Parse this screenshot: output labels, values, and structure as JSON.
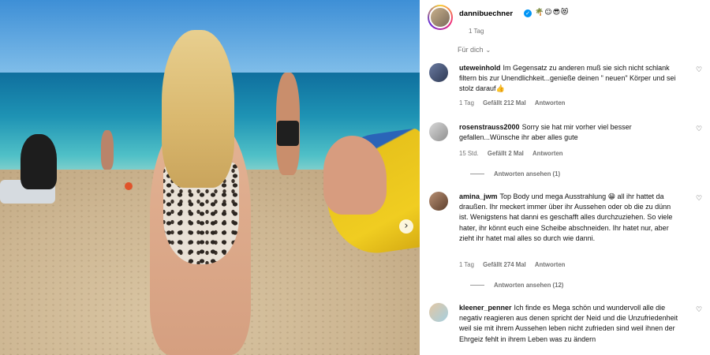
{
  "post": {
    "username": "dannibuechner",
    "header_emojis": "🌴☺😎😻",
    "time": "1 Tag",
    "sort_label": "Für dich"
  },
  "comments": [
    {
      "user": "uteweinhold",
      "text": "Im Gegensatz zu anderen muß sie sich nicht schlank filtern bis zur Unendlichkeit...genieße deinen \" neuen\" Körper und sei stolz darauf👍",
      "time": "1 Tag",
      "likes": "Gefällt 212 Mal",
      "reply": "Antworten"
    },
    {
      "user": "rosenstrauss2000",
      "text": "Sorry sie hat mir vorher viel besser gefallen...Wünsche ihr aber alles gute",
      "time": "15 Std.",
      "likes": "Gefällt 2 Mal",
      "reply": "Antworten",
      "view_replies": "Antworten ansehen (1)"
    },
    {
      "user": "amina_jwm",
      "text": "Top Body und mega Ausstrahlung 😁 all ihr hattet da draußen. Ihr meckert immer über ihr Aussehen oder ob die zu dünn ist. Wenigstens hat danni es geschafft alles durchzuziehen. So viele hater, ihr könnt euch eine Scheibe abschneiden. Ihr hatet nur, aber zieht ihr hatet mal alles so durch wie danni.",
      "time": "1 Tag",
      "likes": "Gefällt 274 Mal",
      "reply": "Antworten",
      "view_replies": "Antworten ansehen (12)"
    },
    {
      "user": "kleener_penner",
      "text": "Ich finde es Mega schön und wundervoll alle die negativ reagieren aus denen spricht der Neid und die Unzufriedenheit weil sie mit ihrem Aussehen leben nicht zufrieden sind weil ihnen der Ehrgeiz fehlt in ihrem Leben was zu ändern"
    }
  ],
  "icons": {
    "heart": "heart-outline-icon",
    "next": "chevron-right-icon",
    "verified": "verified-badge-icon",
    "chevron": "chevron-down-icon"
  },
  "colors": {
    "meta_gray": "#737373",
    "verified_blue": "#0095f6"
  }
}
